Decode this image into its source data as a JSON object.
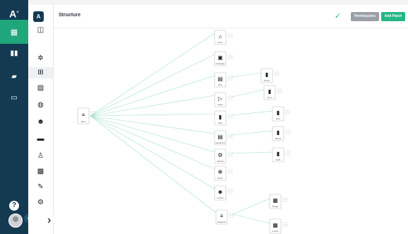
{
  "app": {
    "logo_text": "A",
    "panel_logo": "A"
  },
  "rail": {
    "items": [
      {
        "name": "grid-icon",
        "glyph": "▦"
      },
      {
        "name": "bar-chart-icon",
        "glyph": "▮"
      },
      {
        "name": "briefcase-icon",
        "glyph": "▰"
      },
      {
        "name": "toolbox-icon",
        "glyph": "▭"
      }
    ],
    "help": "?"
  },
  "panel": {
    "items": [
      {
        "name": "dashboard-icon",
        "glyph": "◫"
      },
      {
        "name": "puzzle-icon",
        "glyph": "✲"
      },
      {
        "name": "hierarchy-icon",
        "glyph": "⊞"
      },
      {
        "name": "image-icon",
        "glyph": "▨"
      },
      {
        "name": "palette-icon",
        "glyph": "◍"
      },
      {
        "name": "users-icon",
        "glyph": "☻"
      },
      {
        "name": "truck-icon",
        "glyph": "▬"
      },
      {
        "name": "shirt-icon",
        "glyph": "♙"
      },
      {
        "name": "picture-icon",
        "glyph": "▩"
      },
      {
        "name": "pen-icon",
        "glyph": "✎"
      },
      {
        "name": "settings-icon",
        "glyph": "⚙"
      }
    ]
  },
  "header": {
    "title": "Structure",
    "permissions_label": "Permissions",
    "add_patch_label": "Add Patch"
  },
  "colors": {
    "rail": "#143a52",
    "accent": "#24b884",
    "edge": "#9fe0c6"
  },
  "diagram": {
    "root": {
      "label": "Menu",
      "glyph": "≡"
    },
    "nodes": [
      {
        "label": "Home",
        "glyph": "⌂"
      },
      {
        "label": "Homepage",
        "glyph": "▣"
      },
      {
        "label": "Shop",
        "glyph": "▤"
      },
      {
        "label": "Videos",
        "glyph": "▷"
      },
      {
        "label": "Stats",
        "glyph": "▮"
      },
      {
        "label": "Appearance",
        "glyph": "▤"
      },
      {
        "label": "Settings",
        "glyph": "⚙"
      },
      {
        "label": "Winter",
        "glyph": "✻"
      },
      {
        "label": "Contact",
        "glyph": "☻"
      },
      {
        "label": "Categories",
        "glyph": "≡"
      }
    ],
    "leaves": [
      {
        "label": "Privacy",
        "glyph": "▮"
      },
      {
        "label": "Terms",
        "glyph": "▮"
      },
      {
        "label": "Docs",
        "glyph": "▮"
      },
      {
        "label": "Manual",
        "glyph": "▮"
      },
      {
        "label": "Guide",
        "glyph": "▮"
      },
      {
        "label": "Storage",
        "glyph": "▦"
      },
      {
        "label": "Archive",
        "glyph": "▦"
      }
    ]
  }
}
